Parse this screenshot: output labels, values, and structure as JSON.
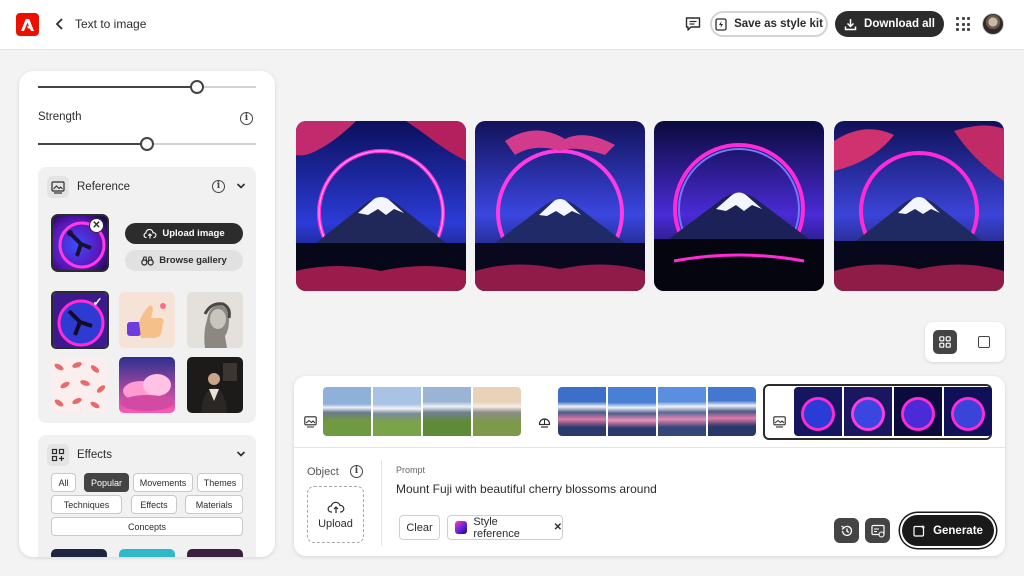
{
  "header": {
    "logo": "adobe-logo",
    "title": "Text to image",
    "save_style_kit": "Save as style kit",
    "download_all": "Download all"
  },
  "panel": {
    "strength_label": "Strength",
    "top_slider_value": 0.73,
    "strength_slider_value": 0.5,
    "reference": {
      "label": "Reference",
      "upload_image": "Upload image",
      "browse_gallery": "Browse gallery"
    },
    "effects": {
      "label": "Effects",
      "chips": [
        "All",
        "Popular",
        "Movements",
        "Themes",
        "Techniques",
        "Effects",
        "Materials",
        "Concepts"
      ],
      "active_chip": "Popular"
    }
  },
  "prompt": {
    "object_label": "Object",
    "upload_label": "Upload",
    "prompt_label": "Prompt",
    "prompt_text": "Mount Fuji with beautiful cherry blossoms around",
    "clear_label": "Clear",
    "style_tag": "Style reference",
    "generate_label": "Generate"
  },
  "colors": {
    "accent": "#eb1000",
    "dark": "#2c2c2c",
    "neon_pink": "#ff2bd6",
    "neon_blue": "#4b5bff"
  }
}
